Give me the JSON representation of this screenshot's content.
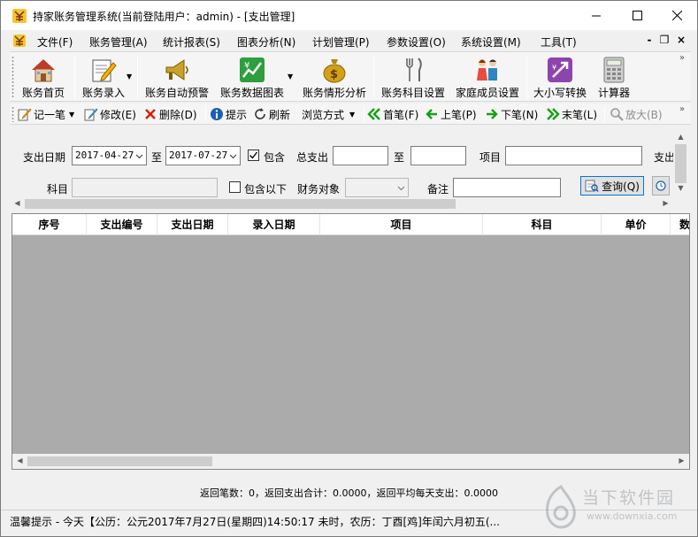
{
  "window": {
    "title": "持家账务管理系统(当前登陆用户：admin) - [支出管理]",
    "controls": {
      "minimize": "minimize",
      "maximize": "maximize",
      "close": "close"
    }
  },
  "menu": {
    "items": [
      "文件(F)",
      "账务管理(A)",
      "统计报表(S)",
      "图表分析(N)",
      "计划管理(P)",
      "参数设置(O)",
      "系统设置(M)",
      "工具(T)"
    ],
    "mdi": {
      "minimize": "-",
      "restore": "❐",
      "close": "×"
    }
  },
  "big_toolbar": {
    "items": [
      {
        "label": "账务首页",
        "icon": "house-icon"
      },
      {
        "label": "账务录入",
        "icon": "notepad-pencil-icon"
      },
      {
        "label": "账务自动预警",
        "icon": "horn-icon"
      },
      {
        "label": "账务数据图表",
        "icon": "chart-icon"
      },
      {
        "label": "账务情形分析",
        "icon": "money-bag-icon"
      },
      {
        "label": "账务科目设置",
        "icon": "fork-knife-icon"
      },
      {
        "label": "家庭成员设置",
        "icon": "family-icon"
      },
      {
        "label": "大小写转换",
        "icon": "convert-icon"
      },
      {
        "label": "计算器",
        "icon": "calculator-icon"
      }
    ]
  },
  "small_toolbar": {
    "items": [
      {
        "label": "记一笔",
        "icon": "write-icon",
        "enabled": true
      },
      {
        "label": "修改(E)",
        "icon": "edit-icon",
        "enabled": true
      },
      {
        "label": "删除(D)",
        "icon": "delete-icon",
        "enabled": true
      },
      {
        "label": "提示",
        "icon": "info-icon",
        "enabled": true
      },
      {
        "label": "刷新",
        "icon": "refresh-icon",
        "enabled": true
      },
      {
        "label": "浏览方式",
        "icon": "",
        "enabled": true
      },
      {
        "label": "首笔(F)",
        "icon": "first-icon",
        "enabled": true
      },
      {
        "label": "上笔(P)",
        "icon": "prev-icon",
        "enabled": true
      },
      {
        "label": "下笔(N)",
        "icon": "next-icon",
        "enabled": true
      },
      {
        "label": "末笔(L)",
        "icon": "last-icon",
        "enabled": true
      },
      {
        "label": "放大(B)",
        "icon": "zoom-icon",
        "enabled": false
      }
    ]
  },
  "filters": {
    "date_label": "支出日期",
    "date_from": "2017-04-27",
    "to_label": "至",
    "date_to": "2017-07-27",
    "include_label": "包含",
    "include_checked": true,
    "total_label": "总支出",
    "total_from": "",
    "total_to_label": "至",
    "total_to": "",
    "item_label": "项目",
    "item_value": "",
    "cut_label": "支出",
    "subject_label": "科目",
    "subject_value": "",
    "include_below_label": "包含以下",
    "include_below_checked": false,
    "target_label": "财务对象",
    "target_value": "",
    "remark_label": "备注",
    "remark_value": "",
    "query_button": "查询(Q)"
  },
  "grid": {
    "columns": [
      "序号",
      "支出编号",
      "支出日期",
      "录入日期",
      "项目",
      "科目",
      "单价",
      "数"
    ],
    "rows": []
  },
  "summary": "返回笔数：0，返回支出合计：0.0000，返回平均每天支出：0.0000",
  "status": "温馨提示 - 今天【公历：公元2017年7月27日(星期四)14:50:17 未时，农历：丁酉[鸡]年闰六月初五(...",
  "watermark": {
    "name": "当下软件园",
    "url": "www.downxia.com"
  },
  "colors": {
    "accent": "#0078d7",
    "grid_bg": "#ababab",
    "nav_green": "#16a016",
    "delete_red": "#d81e06"
  }
}
